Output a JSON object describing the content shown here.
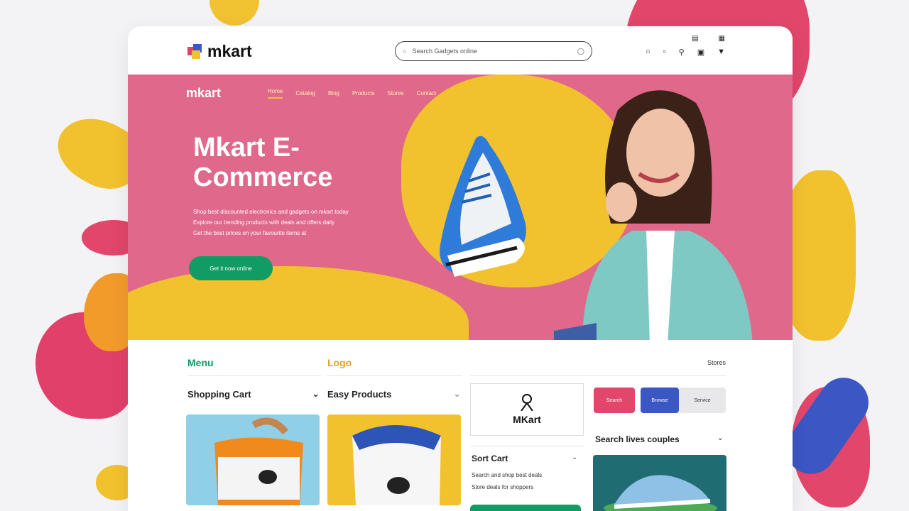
{
  "topbar": {
    "brand": "mkart",
    "search_placeholder": "Search Gadgets online",
    "icons": [
      "message-icon",
      "cart-icon",
      "search-icon",
      "user-icon",
      "filter-icon"
    ]
  },
  "hero": {
    "brand": "mkart",
    "nav": [
      "Home",
      "Catalog",
      "Blog",
      "Products",
      "Stores",
      "Contact"
    ],
    "title": "Mkart  E-Commerce",
    "copy_line1": "Shop best discounted electronics and gadgets on mkart today",
    "copy_line2": "Explore our trending products with deals and offers daily",
    "copy_line3": "Get the best prices on your favourite items at",
    "cta": "Get it now online"
  },
  "lower": {
    "menu_title": "Menu",
    "logo_title": "Logo",
    "right_label": "Stores",
    "shopping_cart": "Shopping Cart",
    "easy_products": "Easy Products",
    "mkart_box": "MKart",
    "sort_cart": "Sort Cart",
    "sort_line1": "Search and shop best deals",
    "sort_line2": "Store deals for shoppers",
    "chips": [
      "Search",
      "Browse",
      "Service"
    ],
    "search_title": "Search lives couples"
  },
  "colors": {
    "pink": "#e0688a",
    "yellow": "#f2c12e",
    "green": "#109c62",
    "blue": "#3b57c4"
  }
}
